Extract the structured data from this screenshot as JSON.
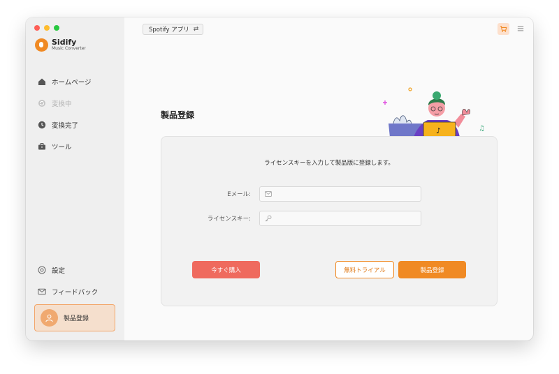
{
  "app": {
    "name": "Sidify",
    "subtitle": "Music Converter"
  },
  "source": {
    "label": "Spotify アプリ"
  },
  "sidebar": {
    "items": [
      {
        "label": "ホームページ",
        "icon": "home-icon",
        "state": "normal"
      },
      {
        "label": "変換中",
        "icon": "converting-icon",
        "state": "disabled"
      },
      {
        "label": "変換完了",
        "icon": "clock-icon",
        "state": "normal"
      },
      {
        "label": "ツール",
        "icon": "toolbox-icon",
        "state": "normal"
      }
    ],
    "bottom": [
      {
        "label": "設定",
        "icon": "gear-icon"
      },
      {
        "label": "フィードバック",
        "icon": "mail-icon"
      }
    ],
    "register": {
      "label": "製品登録",
      "icon": "user-icon"
    }
  },
  "main": {
    "title": "製品登録",
    "instruction": "ライセンスキーを入力して製品版に登録します。",
    "email": {
      "label": "Eメール:",
      "value": "",
      "placeholder": "",
      "icon": "envelope-icon"
    },
    "license": {
      "label": "ライセンスキー:",
      "value": "",
      "placeholder": "",
      "icon": "key-icon"
    },
    "buttons": {
      "buy": "今すぐ購入",
      "trial": "無料トライアル",
      "register": "製品登録"
    }
  },
  "colors": {
    "accent": "#f08a24",
    "buy": "#ef6a5e",
    "register_card": "#f5dfcd",
    "sidebar": "#efefef"
  }
}
